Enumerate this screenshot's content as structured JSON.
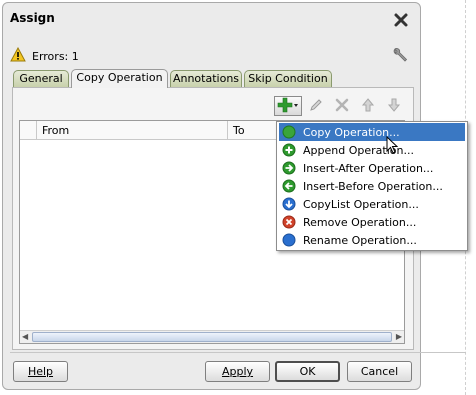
{
  "dialog": {
    "title": "Assign"
  },
  "errors": {
    "label": "Errors: 1"
  },
  "tabs": [
    {
      "label": "General"
    },
    {
      "label": "Copy Operation"
    },
    {
      "label": "Annotations"
    },
    {
      "label": "Skip Condition"
    }
  ],
  "table": {
    "columns": [
      "From",
      "To"
    ]
  },
  "menu": {
    "items": [
      {
        "label": "Copy Operation...",
        "icon": "green-circle-icon",
        "color": "#3aa53a"
      },
      {
        "label": "Append Operation...",
        "icon": "plus-circle-icon",
        "color": "#2e9a2e"
      },
      {
        "label": "Insert-After Operation...",
        "icon": "arrow-right-circle-icon",
        "color": "#2e9a2e"
      },
      {
        "label": "Insert-Before Operation...",
        "icon": "arrow-left-circle-icon",
        "color": "#2e9a2e"
      },
      {
        "label": "CopyList Operation...",
        "icon": "arrow-down-circle-icon",
        "color": "#2a6fcf"
      },
      {
        "label": "Remove Operation...",
        "icon": "x-circle-icon",
        "color": "#d0422a"
      },
      {
        "label": "Rename Operation...",
        "icon": "blue-circle-icon",
        "color": "#2a6fcf"
      }
    ]
  },
  "buttons": {
    "help": "Help",
    "apply": "Apply",
    "ok": "OK",
    "cancel": "Cancel"
  },
  "colors": {
    "selection": "#3a78c3",
    "tab_green": "#c8d1ab"
  }
}
